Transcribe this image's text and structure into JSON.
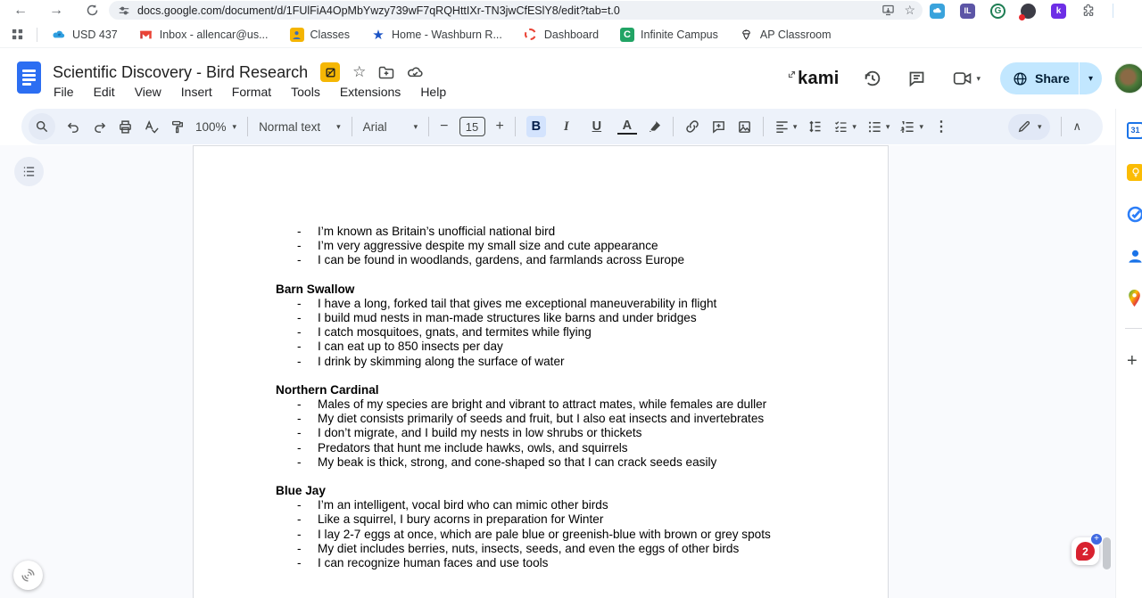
{
  "chrome": {
    "url": "docs.google.com/document/d/1FUlFiA4OpMbYwzy739wF7qRQHttIXr-TN3jwCfESlY8/edit?tab=t.0",
    "extensions": {
      "il_text": "IL",
      "g_letter": "G",
      "kami_letter": "k"
    }
  },
  "bookmarks": {
    "items": [
      {
        "label": "USD 437",
        "icon": "cloud"
      },
      {
        "label": "Inbox - allencar@us...",
        "icon": "gmail"
      },
      {
        "label": "Classes",
        "icon": "person-square"
      },
      {
        "label": "Home - Washburn R...",
        "icon": "blue-star"
      },
      {
        "label": "Dashboard",
        "icon": "dashed-circle"
      },
      {
        "label": "Infinite Campus",
        "icon": "green-c"
      },
      {
        "label": "AP Classroom",
        "icon": "acorn"
      }
    ],
    "green_c_letter": "C"
  },
  "docs": {
    "title": "Scientific Discovery - Bird Research",
    "menus": [
      "File",
      "Edit",
      "View",
      "Insert",
      "Format",
      "Tools",
      "Extensions",
      "Help"
    ],
    "kami_wordmark": "kami",
    "share_label": "Share",
    "toolbar": {
      "zoom_value": "100%",
      "paragraph_style": "Normal text",
      "font_name": "Arial",
      "font_size": "15"
    }
  },
  "doc_content": {
    "bullet_char": "-",
    "sections": [
      {
        "bullets": [
          "I’m known as Britain’s unofficial national bird",
          "I’m very aggressive despite my small size and cute appearance",
          "I can be found in woodlands, gardens, and farmlands across Europe"
        ]
      },
      {
        "heading": "Barn Swallow",
        "bullets": [
          "I have a long, forked tail that gives me exceptional maneuverability in flight",
          "I build mud nests in man-made structures like barns and under bridges",
          "I catch mosquitoes, gnats, and termites while flying",
          "I can eat up to 850 insects per day",
          "I drink by skimming along the surface of water"
        ]
      },
      {
        "heading": "Northern Cardinal",
        "bullets": [
          "Males of my species are bright and vibrant to attract mates, while females are duller",
          "My diet consists primarily of seeds and fruit, but I also eat insects and invertebrates",
          "I don’t migrate, and I build my nests in low shrubs or thickets",
          "Predators that hunt me include hawks, owls, and squirrels",
          "My beak is thick, strong, and cone-shaped so that I can crack seeds easily"
        ]
      },
      {
        "heading": "Blue Jay",
        "bullets": [
          "I’m an intelligent, vocal bird who can mimic other birds",
          "Like a squirrel, I bury acorns in preparation for Winter",
          "I lay 2-7 eggs at once, which are pale blue or greenish-blue with brown or grey spots",
          "My diet includes berries, nuts, insects, seeds, and even the eggs of other birds",
          "I can recognize human faces and use tools"
        ]
      }
    ]
  },
  "side_rail": {
    "calendar_day": "31"
  },
  "badge": {
    "count": "2",
    "plus": "+"
  },
  "glyphs": {
    "back": "←",
    "forward": "→",
    "star_outline": "☆",
    "star_filled": "★",
    "caret": "▾",
    "more_vertical": "⋮",
    "minus": "−",
    "plus": "+",
    "bold": "B",
    "italic": "I",
    "underline": "U",
    "text_color": "A",
    "collapse": "∧",
    "chevron_right": "›"
  },
  "colors": {
    "share_bg": "#c2e7ff",
    "toolbar_bg": "#edf2fa",
    "active_control_bg": "#d3e3fd",
    "docs_blue": "#2c6ef2",
    "badge_red": "#d8222f",
    "badge_blue": "#4069e1",
    "kami_yellow": "#f5b704",
    "kami_purple": "#6d2ee6"
  }
}
